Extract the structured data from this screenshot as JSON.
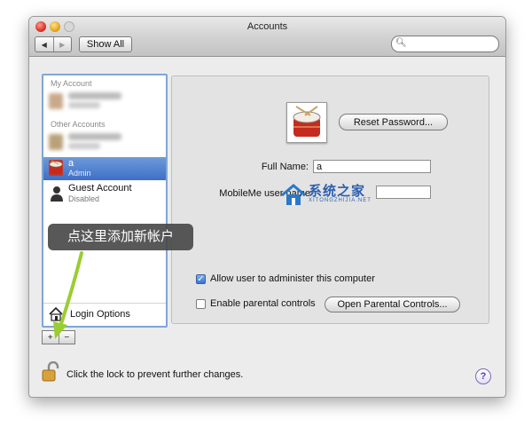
{
  "window": {
    "title": "Accounts"
  },
  "toolbar": {
    "back_icon": "◀",
    "forward_icon": "▶",
    "show_all_label": "Show All",
    "search_placeholder": ""
  },
  "sidebar": {
    "my_account_header": "My Account",
    "other_accounts_header": "Other Accounts",
    "selected_account": {
      "name": "a",
      "role": "Admin"
    },
    "guest_account": {
      "name": "Guest Account",
      "status": "Disabled"
    },
    "login_options_label": "Login Options"
  },
  "account_buttons": {
    "add_label": "+",
    "remove_label": "−"
  },
  "details": {
    "reset_password_label": "Reset Password...",
    "full_name_label": "Full Name:",
    "full_name_value": "a",
    "mobileme_label": "MobileMe user name",
    "allow_admin_label": "Allow user to administer this computer",
    "allow_admin_checked": true,
    "parental_controls_label": "Enable parental controls",
    "parental_controls_checked": false,
    "open_parental_label": "Open Parental Controls..."
  },
  "watermark": {
    "text": "系统之家",
    "subtext": "XITONGZHIJIA.NET"
  },
  "annotation": {
    "tooltip": "点这里添加新帐户"
  },
  "footer": {
    "lock_text": "Click the lock to prevent further changes.",
    "help_label": "?"
  },
  "colors": {
    "selection": "#3d6fc7",
    "annotation_arrow": "#9acd32",
    "help_accent": "#5b3fb5"
  }
}
